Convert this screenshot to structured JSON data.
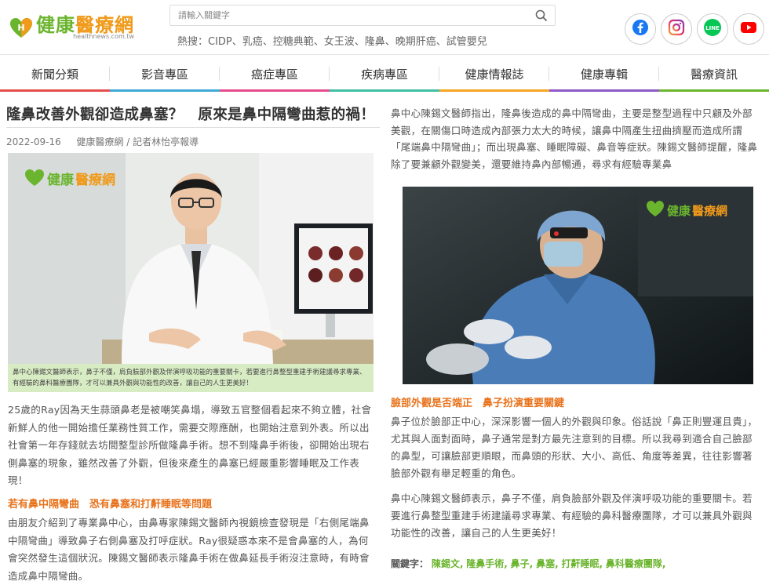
{
  "header": {
    "logo_cn_a": "健康",
    "logo_cn_b": "醫療網",
    "logo_url": "healthnews.com.tw",
    "search_placeholder": "請輸入關鍵字",
    "hot_label": "熱搜：",
    "hot_terms": "CIDP、乳癌、控糖典範、女王波、隆鼻、晚期肝癌、試管嬰兒",
    "social": [
      {
        "name": "facebook-icon",
        "color": "#1877f2"
      },
      {
        "name": "instagram-icon",
        "color": "#c13584"
      },
      {
        "name": "line-icon",
        "color": "#06c755"
      },
      {
        "name": "youtube-icon",
        "color": "#ff0000"
      }
    ]
  },
  "nav": {
    "items": [
      {
        "label": "新聞分類",
        "color": "#e64c4c"
      },
      {
        "label": "影音專區",
        "color": "#3fa9d6"
      },
      {
        "label": "癌症專區",
        "color": "#e64c8b"
      },
      {
        "label": "疾病專區",
        "color": "#3fbfa3"
      },
      {
        "label": "健康情報誌",
        "color": "#f5a623"
      },
      {
        "label": "健康專輯",
        "color": "#8e59c8"
      },
      {
        "label": "醫療資訊",
        "color": "#6bb52e"
      }
    ]
  },
  "article": {
    "title": "隆鼻改善外觀卻造成鼻塞？　原來是鼻中隔彎曲惹的禍！",
    "date": "2022-09-16",
    "byline": "健康醫療網 / 記者林怡亭報導",
    "photo_watermark_a": "健康",
    "photo_watermark_b": "醫療網",
    "caption": "鼻中心陳錫文醫師表示，鼻子不僅，肩負臉部外觀及伴演呼吸功能的重要關卡，若要進行鼻整型重建手術建議尋求專業、有經驗的鼻科醫療團隊，才可以兼具外觀與功能性的改善，讓自己的人生更美好！",
    "paragraph1": "25歲的Ray因為天生蒜頭鼻老是被嘲笑鼻塌，導致五官整個看起來不夠立體，社會新鮮人的他一開始擔任業務性質工作，需要交際應酬，也開始注意到外表。所以出社會第一年存錢就去坊間整型診所做隆鼻手術。想不到隆鼻手術後，卻開始出現右側鼻塞的現象，雖然改善了外觀，但後來產生的鼻塞已經嚴重影響睡眠及工作表現！",
    "subhead1": "若有鼻中隔彎曲　恐有鼻塞和打鼾睡眠等問題",
    "paragraph2": "由朋友介紹到了專業鼻中心，由鼻專家陳錫文醫師內視鏡檢查發現是「右側尾端鼻中隔彎曲」導致鼻子右側鼻塞及打呼症狀。Ray很疑惑本來不是會鼻塞的人，為何會突然發生這個狀況。陳錫文醫師表示隆鼻手術在做鼻延長手術沒注意時，有時會造成鼻中隔彎曲。",
    "paragraph3": "鼻中心陳錫文醫師指出，隆鼻後造成的鼻中隔彎曲，主要是整型過程中只顧及外部美觀，在關傷口時造成內部張力太大的時候，讓鼻中隔產生扭曲擠壓而造成所謂「尾端鼻中隔彎曲」；而出現鼻塞、睡眠障礙、鼻音等症狀。陳錫文醫師提醒，隆鼻除了要兼顧外觀變美，還要維持鼻內部暢通，尋求有經驗專業鼻",
    "subhead2": "臉部外觀是否端正　鼻子扮演重要關鍵",
    "paragraph4": "鼻子位於臉部正中心，深深影響一個人的外觀與印象。俗話說「鼻正則豐運且貴」，尤其與人面對面時，鼻子通常是對方最先注意到的目標。所以我尋到適合自己臉部的鼻型，可讓臉部更順眼，而鼻頭的形狀、大小、高低、角度等差異，往往影響著臉部外觀有舉足輕重的角色。",
    "paragraph5": "鼻中心陳錫文醫師表示，鼻子不僅，肩負臉部外觀及伴演呼吸功能的重要關卡。若要進行鼻整型重建手術建議尋求專業、有經驗的鼻科醫療團隊，才可以兼具外觀與功能性的改善，讓自己的人生更美好！",
    "keywords_label": "關鍵字：",
    "keywords": [
      "陳錫文",
      "隆鼻手術",
      "鼻子",
      "鼻塞",
      "打鼾睡眠",
      "鼻科醫療團隊"
    ]
  }
}
